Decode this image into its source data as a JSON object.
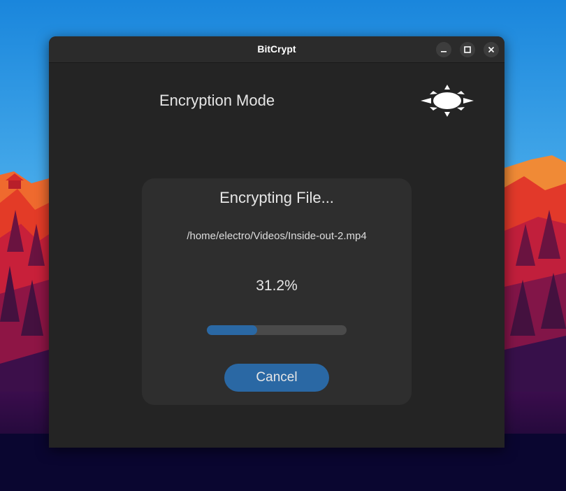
{
  "window": {
    "title": "BitCrypt"
  },
  "header": {
    "mode_title": "Encryption Mode",
    "theme_icon": "sun-icon"
  },
  "progress": {
    "title": "Encrypting File...",
    "file_path": "/home/electro/Videos/Inside-out-2.mp4",
    "percent_label": "31.2%",
    "percent_value": 31.2,
    "bar_fill_fraction": 0.36,
    "cancel_label": "Cancel"
  },
  "colors": {
    "window_bg": "#242424",
    "card_bg": "#2e2e2e",
    "accent": "#2a68a4",
    "track": "#4a4a4a",
    "text": "#e6e6e6"
  }
}
